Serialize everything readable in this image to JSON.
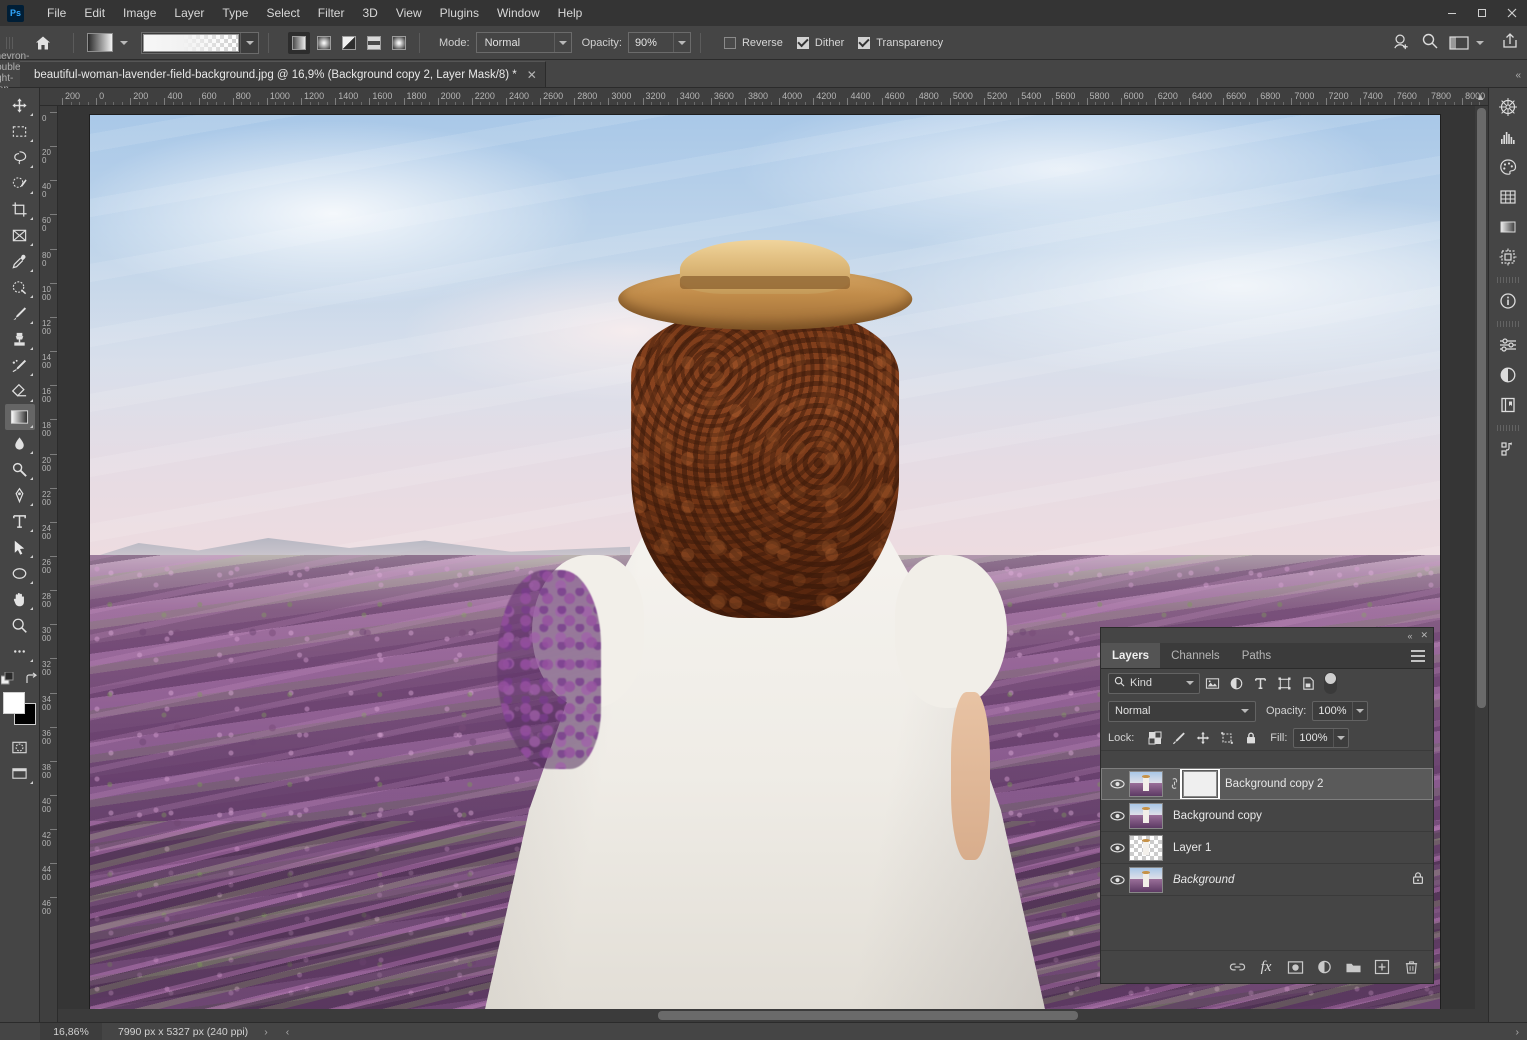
{
  "app": {
    "logo_text": "Ps",
    "menu": [
      "File",
      "Edit",
      "Image",
      "Layer",
      "Type",
      "Select",
      "Filter",
      "3D",
      "View",
      "Plugins",
      "Window",
      "Help"
    ],
    "window_buttons": {
      "minimize": "—",
      "maximize": "□",
      "close": "✕"
    }
  },
  "options_bar": {
    "home_icon": "home-icon",
    "gradient_picker_icon": "gradient-swatch",
    "gradient_preset_label": "Foreground to Transparent",
    "gradient_types": [
      {
        "name": "linear-gradient-type",
        "active": true
      },
      {
        "name": "radial-gradient-type",
        "active": false
      },
      {
        "name": "angle-gradient-type",
        "active": false
      },
      {
        "name": "reflected-gradient-type",
        "active": false
      },
      {
        "name": "diamond-gradient-type",
        "active": false
      }
    ],
    "mode_label": "Mode:",
    "mode_value": "Normal",
    "opacity_label": "Opacity:",
    "opacity_value": "90%",
    "reverse_label": "Reverse",
    "reverse_checked": false,
    "dither_label": "Dither",
    "dither_checked": true,
    "transparency_label": "Transparency",
    "transparency_checked": true,
    "right_icons": [
      "share-user-icon",
      "search-icon",
      "workspace-icon",
      "chevron-down-icon",
      "share-icon"
    ]
  },
  "tabbar": {
    "expand_icon": "chevron-double-right-icon",
    "document_title": "beautiful-woman-lavender-field-background.jpg @ 16,9% (Background copy 2, Layer Mask/8) *",
    "close_icon": "✕",
    "collapse_icon": "«"
  },
  "toolbar": {
    "tools": [
      {
        "name": "move-tool",
        "label": "Move Tool",
        "active": false
      },
      {
        "name": "rectangular-marquee-tool",
        "label": "Rectangular Marquee Tool",
        "active": false
      },
      {
        "name": "lasso-tool",
        "label": "Lasso Tool",
        "active": false
      },
      {
        "name": "object-selection-tool",
        "label": "Object Selection Tool",
        "active": false
      },
      {
        "name": "crop-tool",
        "label": "Crop Tool",
        "active": false
      },
      {
        "name": "frame-tool",
        "label": "Frame Tool",
        "active": false
      },
      {
        "name": "eyedropper-tool",
        "label": "Eyedropper Tool",
        "active": false
      },
      {
        "name": "spot-healing-brush-tool",
        "label": "Spot Healing Brush Tool",
        "active": false
      },
      {
        "name": "brush-tool",
        "label": "Brush Tool",
        "active": false
      },
      {
        "name": "clone-stamp-tool",
        "label": "Clone Stamp Tool",
        "active": false
      },
      {
        "name": "history-brush-tool",
        "label": "History Brush Tool",
        "active": false
      },
      {
        "name": "eraser-tool",
        "label": "Eraser Tool",
        "active": false
      },
      {
        "name": "gradient-tool",
        "label": "Gradient Tool",
        "active": true
      },
      {
        "name": "blur-tool",
        "label": "Blur Tool",
        "active": false
      },
      {
        "name": "dodge-tool",
        "label": "Dodge Tool",
        "active": false
      },
      {
        "name": "pen-tool",
        "label": "Pen Tool",
        "active": false
      },
      {
        "name": "horizontal-type-tool",
        "label": "Horizontal Type Tool",
        "active": false
      },
      {
        "name": "path-selection-tool",
        "label": "Path Selection Tool",
        "active": false
      },
      {
        "name": "ellipse-tool",
        "label": "Ellipse Tool",
        "active": false
      },
      {
        "name": "hand-tool",
        "label": "Hand Tool",
        "active": false
      },
      {
        "name": "zoom-tool",
        "label": "Zoom Tool",
        "active": false
      },
      {
        "name": "edit-toolbar-tool",
        "label": "Edit Toolbar",
        "active": false
      }
    ],
    "foreground_color": "#ffffff",
    "background_color": "#000000",
    "quick_mask_label": "Edit in Quick Mask Mode",
    "screen_mode_label": "Change Screen Mode"
  },
  "rulers": {
    "unit": "px",
    "h_labels": [
      "200",
      "0",
      "200",
      "400",
      "600",
      "800",
      "1000",
      "1200",
      "1400",
      "1600",
      "1800",
      "2000",
      "2200",
      "2400",
      "2600",
      "2800",
      "3000",
      "3200",
      "3400",
      "3600",
      "3800",
      "4000",
      "4200",
      "4400",
      "4600",
      "4800",
      "5000",
      "5200",
      "5400",
      "5600",
      "5800",
      "6000",
      "6200",
      "6400",
      "6600",
      "6800",
      "7000",
      "7200",
      "7400",
      "7600",
      "7800",
      "8000"
    ],
    "v_labels": [
      "0",
      "200",
      "400",
      "600",
      "800",
      "1000",
      "1200",
      "1400",
      "1600",
      "1800",
      "2000",
      "2200",
      "2400",
      "2600",
      "2800",
      "3000",
      "3200",
      "3400",
      "3600",
      "3800",
      "4000",
      "4200",
      "4400",
      "4600"
    ]
  },
  "right_rail": {
    "icons": [
      {
        "name": "color-wheel-icon",
        "label": "Color"
      },
      {
        "name": "histogram-icon",
        "label": "Histogram"
      },
      {
        "name": "swatches-palette-icon",
        "label": "Swatches"
      },
      {
        "name": "grid-pattern-icon",
        "label": "Patterns"
      },
      {
        "name": "gradients-icon",
        "label": "Gradients"
      },
      {
        "name": "shapes-icon",
        "label": "Shapes"
      },
      {
        "name": "info-icon",
        "label": "Info"
      },
      {
        "name": "adjustments-icon",
        "label": "Adjustments"
      },
      {
        "name": "half-circle-icon",
        "label": "Properties"
      },
      {
        "name": "libraries-icon",
        "label": "Libraries"
      },
      {
        "name": "actions-icon",
        "label": "Actions"
      }
    ]
  },
  "layers_panel": {
    "collapse_icon": "«",
    "close_icon": "✕",
    "tabs": [
      {
        "label": "Layers",
        "active": true
      },
      {
        "label": "Channels",
        "active": false
      },
      {
        "label": "Paths",
        "active": false
      }
    ],
    "menu_icon": "panel-menu-icon",
    "filter": {
      "search_icon": "search-icon",
      "kind_label": "Kind",
      "chevron": "chevron-down-icon",
      "type_filters": [
        "pixel-layer-filter-icon",
        "adjustment-layer-filter-icon",
        "type-layer-filter-icon",
        "shape-layer-filter-icon",
        "smart-object-filter-icon"
      ],
      "toggle_name": "filter-enable-toggle"
    },
    "blend_mode_label": "Normal",
    "opacity_label": "Opacity:",
    "opacity_value": "100%",
    "lock_label": "Lock:",
    "lock_icons": [
      "lock-transparent-pixels-icon",
      "lock-image-pixels-icon",
      "lock-position-icon",
      "lock-artboard-nesting-icon",
      "lock-all-icon"
    ],
    "fill_label": "Fill:",
    "fill_value": "100%",
    "layers": [
      {
        "name": "Background copy 2",
        "visible": true,
        "selected": true,
        "has_mask": true,
        "linked": true,
        "locked": false,
        "italic": false,
        "transparent_thumb": false
      },
      {
        "name": "Background copy",
        "visible": true,
        "selected": false,
        "has_mask": false,
        "linked": false,
        "locked": false,
        "italic": false,
        "transparent_thumb": false
      },
      {
        "name": "Layer 1",
        "visible": true,
        "selected": false,
        "has_mask": false,
        "linked": false,
        "locked": false,
        "italic": false,
        "transparent_thumb": true
      },
      {
        "name": "Background",
        "visible": true,
        "selected": false,
        "has_mask": false,
        "linked": false,
        "locked": true,
        "italic": true,
        "transparent_thumb": false
      }
    ],
    "bottom_buttons": [
      {
        "name": "link-layers-button",
        "label": "Link layers"
      },
      {
        "name": "add-layer-style-button",
        "label": "fx"
      },
      {
        "name": "add-layer-mask-button",
        "label": "Add layer mask"
      },
      {
        "name": "new-adjustment-layer-button",
        "label": "New fill or adjustment layer"
      },
      {
        "name": "new-group-button",
        "label": "Create a new group"
      },
      {
        "name": "new-layer-button",
        "label": "Create a new layer"
      },
      {
        "name": "delete-layer-button",
        "label": "Delete layer"
      }
    ]
  },
  "status_bar": {
    "zoom": "16,86%",
    "doc_info": "7990 px x 5327 px (240 ppi)",
    "arrow_right": "›",
    "arrow_left": "‹",
    "arrow_far_right": "›"
  }
}
